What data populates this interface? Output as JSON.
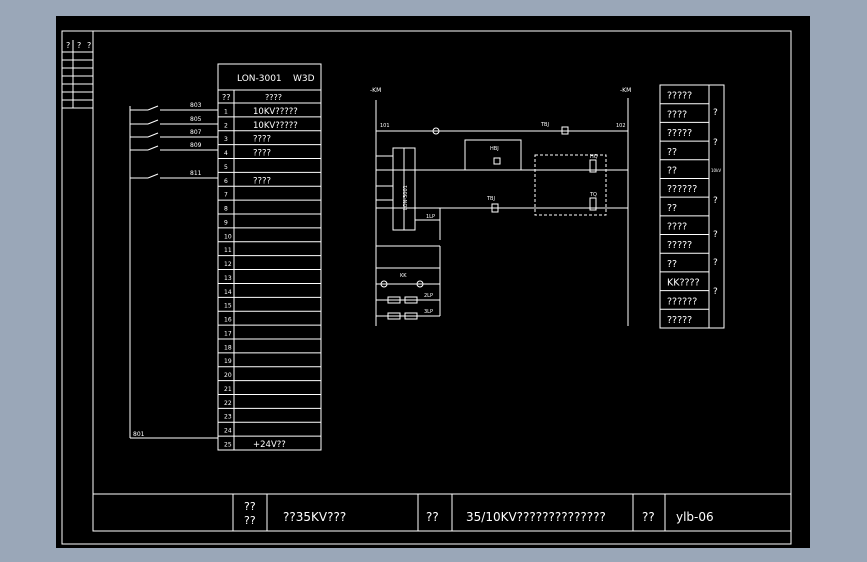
{
  "title_block": {
    "label_a": "??\n??",
    "project": "??35KV???",
    "label_b": "??",
    "drawing_title": "35/10KV??????????????",
    "label_c": "??",
    "drawing_no": "ylb-06"
  },
  "revision_header": [
    "?",
    "?",
    "?"
  ],
  "terminal_table": {
    "device_name": "LON-3001",
    "device_code": "W3D",
    "col1_header": "??",
    "col2_header": "????",
    "rows": [
      {
        "n": "1",
        "desc": "10KV?????"
      },
      {
        "n": "2",
        "desc": "10KV?????"
      },
      {
        "n": "3",
        "desc": "????"
      },
      {
        "n": "4",
        "desc": "????"
      },
      {
        "n": "5",
        "desc": ""
      },
      {
        "n": "6",
        "desc": "????"
      },
      {
        "n": "7",
        "desc": ""
      },
      {
        "n": "8",
        "desc": ""
      },
      {
        "n": "9",
        "desc": ""
      },
      {
        "n": "10",
        "desc": ""
      },
      {
        "n": "11",
        "desc": ""
      },
      {
        "n": "12",
        "desc": ""
      },
      {
        "n": "13",
        "desc": ""
      },
      {
        "n": "14",
        "desc": ""
      },
      {
        "n": "15",
        "desc": ""
      },
      {
        "n": "16",
        "desc": ""
      },
      {
        "n": "17",
        "desc": ""
      },
      {
        "n": "18",
        "desc": ""
      },
      {
        "n": "19",
        "desc": ""
      },
      {
        "n": "20",
        "desc": ""
      },
      {
        "n": "21",
        "desc": ""
      },
      {
        "n": "22",
        "desc": ""
      },
      {
        "n": "23",
        "desc": ""
      },
      {
        "n": "24",
        "desc": ""
      },
      {
        "n": "25",
        "desc": "+24V??"
      }
    ]
  },
  "input_wires": [
    "803",
    "805",
    "807",
    "809",
    "811",
    "801"
  ],
  "circuit_labels": {
    "left_bus": "-KM",
    "right_bus": "-KM",
    "n101": "101",
    "n102": "102",
    "trip_relay": "TBJ",
    "hold_relay": "HBJ",
    "close_coil": "HQ",
    "trip_coil": "TQ",
    "device": "LON-3001",
    "plate_1": "1LP",
    "plate_2": "2LP",
    "plate_3": "3LP",
    "plate_4": "4LP",
    "switch": "KK",
    "lamp": "LD",
    "lamp2": "HD"
  },
  "legend_table": {
    "left_cells": [
      "?????",
      "????",
      "?????",
      "??",
      "??",
      "??????",
      "??",
      "????",
      "?????",
      "??",
      "KK????",
      "??????",
      "?????"
    ],
    "right_marks": [
      "?",
      "?",
      "?",
      "?",
      "?",
      "?"
    ],
    "small_note": "10kV"
  },
  "colors": {
    "background": "#9aa7b8",
    "drawing": "#000000",
    "lines": "#ffffff"
  }
}
